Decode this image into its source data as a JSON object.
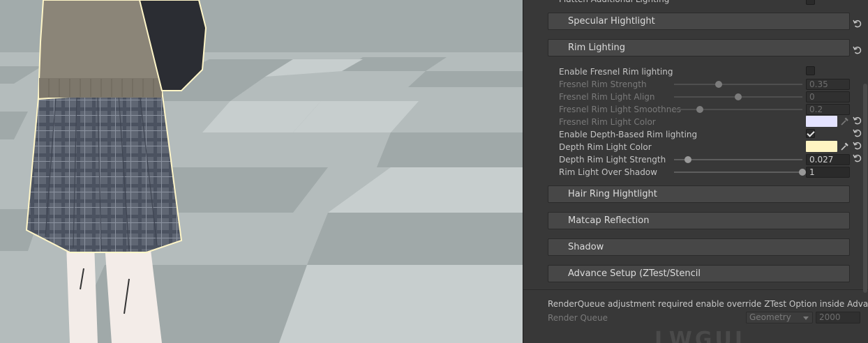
{
  "inspector": {
    "cut_off_row": {
      "label": "Flatten Additional Lighting"
    },
    "sections": {
      "specular": "Specular Hightlight",
      "rim": "Rim Lighting",
      "hair_ring": "Hair Ring Hightlight",
      "matcap": "Matcap Reflection",
      "shadow": "Shadow",
      "advance": "Advance Setup (ZTest/Stencil"
    },
    "rim_properties": {
      "enable_fresnel": {
        "label": "Enable Fresnel Rim lighting",
        "checked": false
      },
      "fresnel_strength": {
        "label": "Fresnel Rim Strength",
        "value": "0.35",
        "slider_fraction": 0.35
      },
      "fresnel_align": {
        "label": "Fresnel Rim Light Align",
        "value": "0",
        "slider_fraction": 0.5
      },
      "fresnel_smoothness": {
        "label": "Fresnel Rim Light Smoothnes",
        "value": "0.2",
        "slider_fraction": 0.2
      },
      "fresnel_color": {
        "label": "Fresnel Rim Light Color",
        "color": "#e4e3ff"
      },
      "enable_depth": {
        "label": "Enable Depth-Based Rim lighting",
        "checked": true
      },
      "depth_color": {
        "label": "Depth Rim Light Color",
        "color": "#fff4c2"
      },
      "depth_strength": {
        "label": "Depth Rim Light Strength",
        "value": "0.027",
        "slider_fraction": 0.11
      },
      "over_shadow": {
        "label": "Rim Light Over Shadow",
        "value": "1",
        "slider_fraction": 1.0
      }
    },
    "render_queue": {
      "info": "RenderQueue adjustment required enable override ZTest Option inside Advance",
      "label": "Render Queue",
      "mode": "Geometry",
      "value": "2000"
    },
    "watermark": "LWGUI"
  },
  "icons": {
    "reset": "reset-icon",
    "eyedropper": "eyedropper-icon",
    "dropdown": "chevron-down-icon"
  }
}
